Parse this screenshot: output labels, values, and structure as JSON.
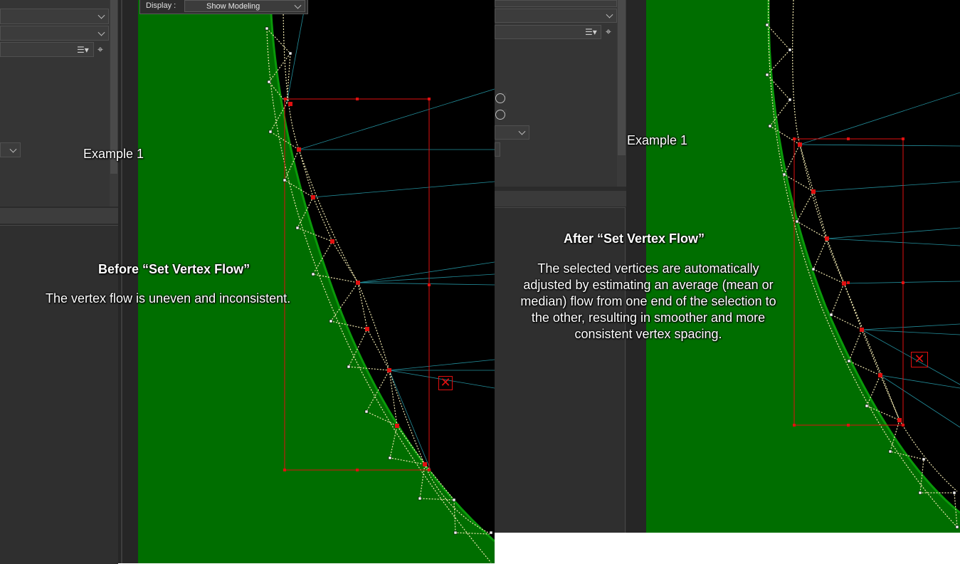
{
  "left": {
    "display_label": "Display :",
    "display_value": "Show Modeling",
    "example_label": "Example 1",
    "heading": "Before “Set Vertex Flow”",
    "body": "The vertex flow is uneven and inconsistent."
  },
  "right": {
    "example_label": "Example 1",
    "heading": "After “Set Vertex Flow”",
    "body_lines": [
      "The selected vertices are automatically",
      "adjusted by estimating an average (mean or",
      "median) flow from one end of the selection to",
      "the other, resulting in smoother and more",
      "consistent vertex spacing."
    ]
  },
  "icons": {
    "list": "list-icon",
    "target": "target-icon",
    "rotate": "rotate-icon",
    "close": "close-x-icon",
    "chevron": "chevron-down-icon"
  },
  "colors": {
    "viewport_green": "#006e00",
    "viewport_black": "#000000",
    "panel_gray": "#333333",
    "selection_red": "#e01010",
    "edge_cyan": "#2aa8b8",
    "edge_dotted": "#f0e8b0"
  }
}
